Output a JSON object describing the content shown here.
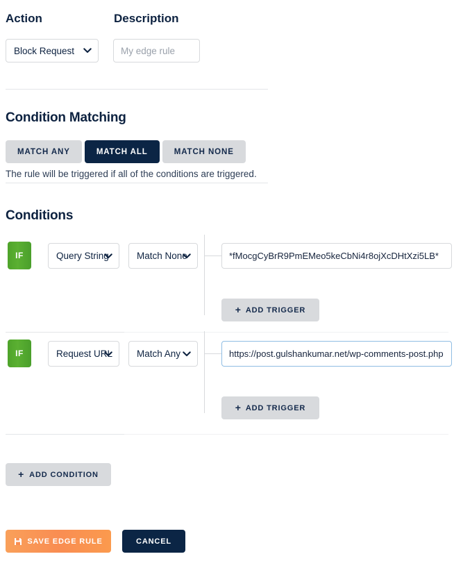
{
  "form": {
    "action": {
      "label": "Action",
      "selected": "Block Request"
    },
    "description": {
      "label": "Description",
      "value": "",
      "placeholder": "My edge rule"
    }
  },
  "condition_matching": {
    "heading": "Condition Matching",
    "options": [
      {
        "label": "MATCH ANY",
        "active": false
      },
      {
        "label": "MATCH ALL",
        "active": true
      },
      {
        "label": "MATCH NONE",
        "active": false
      }
    ],
    "help_text": "The rule will be triggered if all of the conditions are triggered."
  },
  "conditions": {
    "heading": "Conditions",
    "if_badge_label": "IF",
    "add_condition_label": "ADD CONDITION",
    "add_trigger_label": "ADD TRIGGER",
    "plus_glyph": "+",
    "items": [
      {
        "variable": "Query String",
        "operator": "Match None",
        "trigger_value": "*fMocgCyBrR9PmEMeo5keCbNi4r8ojXcDHtXzi5LB*",
        "focused": false
      },
      {
        "variable": "Request URL",
        "operator": "Match Any",
        "trigger_value": "https://post.gulshankumar.net/wp-comments-post.php",
        "focused": true
      }
    ]
  },
  "footer": {
    "save_label": "SAVE EDGE RULE",
    "cancel_label": "CANCEL"
  },
  "colors": {
    "navy": "#0b2545",
    "green": "#4ea32a",
    "orange": "#f98d52",
    "grey_button": "#d8dadd",
    "focus_blue": "#8fbde3"
  }
}
